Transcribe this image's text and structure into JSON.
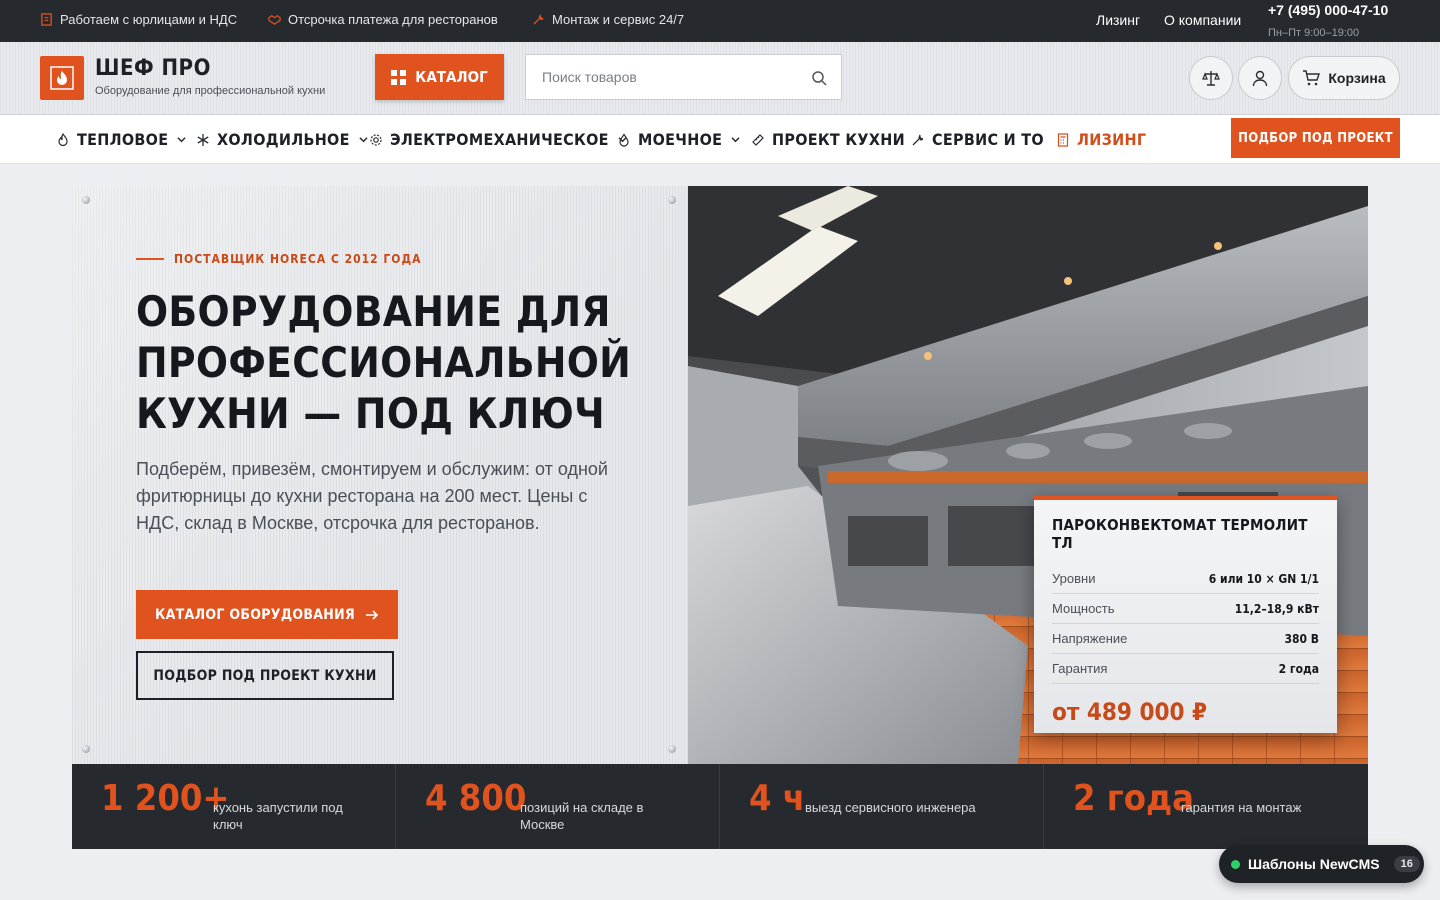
{
  "topbar": {
    "perks": [
      "Работаем с юрлицами и НДС",
      "Отсрочка платежа для ресторанов",
      "Монтаж и сервис 24/7"
    ],
    "links": [
      "Лизинг",
      "О компании"
    ],
    "phone": "+7 (495) 000-47-10",
    "hours": "Пн–Пт 9:00–19:00"
  },
  "header": {
    "logo_title": "ШЕФ ПРО",
    "logo_subtitle": "Оборудование для профессиональной кухни",
    "catalog_label": "КАТАЛОГ",
    "search_placeholder": "Поиск товаров",
    "cart_label": "Корзина"
  },
  "nav": {
    "items": [
      "ТЕПЛОВОЕ",
      "ХОЛОДИЛЬНОЕ",
      "ЭЛЕКТРОМЕХАНИЧЕСКОЕ",
      "МОЕЧНОЕ",
      "ПРОЕКТ КУХНИ",
      "СЕРВИС И ТО",
      "ЛИЗИНГ"
    ],
    "cta": "ПОДБОР ПОД ПРОЕКТ"
  },
  "hero": {
    "eyebrow": "ПОСТАВЩИК HORECA С 2012 ГОДА",
    "title": "ОБОРУДОВАНИЕ ДЛЯ ПРОФЕССИОНАЛЬНОЙ КУХНИ — ПОД КЛЮЧ",
    "text": "Подберём, привезём, смонтируем и обслужим: от одной фритюрницы до кухни ресторана на 200 мест. Цены с НДС, склад в Москве, отсрочка для ресторанов.",
    "primary_button": "КАТАЛОГ ОБОРУДОВАНИЯ",
    "secondary_button": "ПОДБОР ПОД ПРОЕКТ КУХНИ"
  },
  "spec_card": {
    "title": "ПАРОКОНВЕКТОМАТ ТЕРМОЛИТ ТЛ",
    "rows": [
      {
        "key": "Уровни",
        "value": "6 или 10 × GN 1/1"
      },
      {
        "key": "Мощность",
        "value": "11,2–18,9 кВт"
      },
      {
        "key": "Напряжение",
        "value": "380 В"
      },
      {
        "key": "Гарантия",
        "value": "2 года"
      }
    ],
    "price": "от 489 000 ₽"
  },
  "stats": [
    {
      "num": "1 200+",
      "label": "кухонь запустили под ключ"
    },
    {
      "num": "4 800",
      "label": "позиций на складе в Москве"
    },
    {
      "num": "4 ч",
      "label": "выезд сервисного инженера"
    },
    {
      "num": "2 года",
      "label": "гарантия на монтаж"
    }
  ],
  "badge": {
    "label": "Шаблоны NewCMS",
    "count": "16"
  },
  "colors": {
    "accent": "#e0531f",
    "dark": "#26292e",
    "background": "#eceef1"
  }
}
